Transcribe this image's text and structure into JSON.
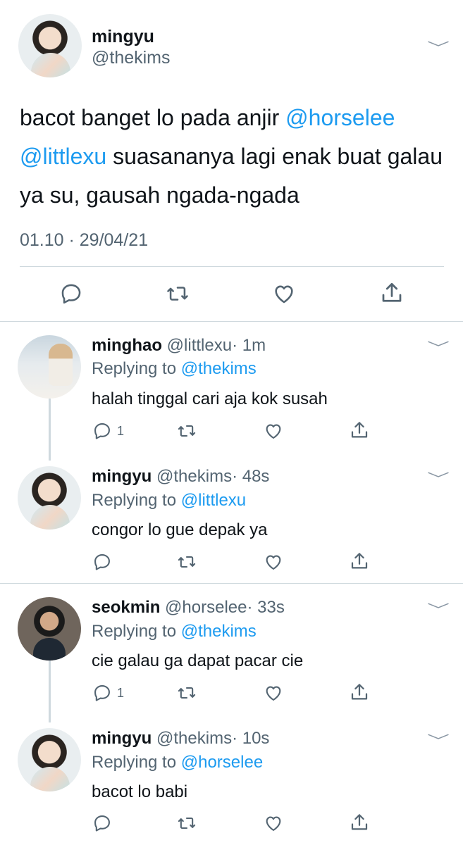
{
  "main_tweet": {
    "name": "mingyu",
    "handle": "@thekims",
    "text_1": "bacot banget lo pada anjir ",
    "mention_1": "@horselee",
    "mention_2": "@littlexu",
    "text_2": " suasananya lagi enak buat galau ya su, gausah ngada-ngada",
    "timestamp": "01.10 · 29/04/21"
  },
  "replies": [
    {
      "name": "minghao",
      "handle": "@littlexu",
      "time": "· 1m",
      "replying_label": "Replying to ",
      "replying_to": "@thekims",
      "text": "halah tinggal cari aja kok susah",
      "reply_count": "1"
    },
    {
      "name": "mingyu",
      "handle": "@thekims",
      "time": "· 48s",
      "replying_label": "Replying to ",
      "replying_to": "@littlexu",
      "text": "congor lo gue depak ya",
      "reply_count": ""
    },
    {
      "name": "seokmin",
      "handle": "@horselee",
      "time": "· 33s",
      "replying_label": "Replying to ",
      "replying_to": "@thekims",
      "text": "cie galau ga dapat pacar cie",
      "reply_count": "1"
    },
    {
      "name": "mingyu",
      "handle": "@thekims",
      "time": "· 10s",
      "replying_label": "Replying to ",
      "replying_to": "@horselee",
      "text": "bacot lo babi",
      "reply_count": ""
    }
  ],
  "icons": [
    "reply-icon",
    "retweet-icon",
    "like-icon",
    "share-icon",
    "chevron-down-icon"
  ],
  "colors": {
    "link": "#1d9bf0",
    "secondary_text": "#536471",
    "divider": "#cfd9de"
  }
}
